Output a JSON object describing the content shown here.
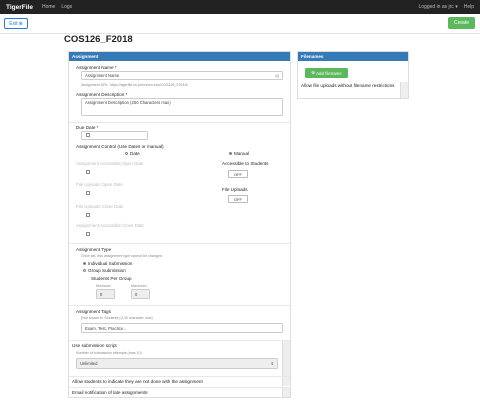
{
  "navbar": {
    "brand": "TigerFile",
    "links": [
      "Home",
      "Logs"
    ],
    "user": "Logged in as jrc ▾",
    "help": "Help"
  },
  "toolbar": {
    "exit_label": "Exit",
    "create_label": "Create"
  },
  "page_title": "COS126_F2018",
  "assignment_panel": {
    "heading": "Assignment",
    "name_label": "Assignment Name *",
    "name_placeholder": "Assignment Name",
    "url_help": "Assignment URL: https://tigerfile.cs.princeton.edu/COS126_F2018/",
    "description_label": "Assignment Description *",
    "description_placeholder": "Assignment Description (250 Characters max)",
    "due_date_label": "Due Date *",
    "control_label": "Assignment Control (Use Dates or manual)",
    "control_date": "Date",
    "control_manual": "Manual",
    "accessible_open_label": "Assignment Accessible Open Date",
    "accessible_to_students_label": "Accessible to Students",
    "accessible_toggle": "OFF",
    "upload_open_label": "File Uploads Open Date",
    "file_uploads_label": "File Uploads",
    "uploads_toggle": "OFF",
    "upload_close_label": "File Uploads Close Date",
    "accessible_close_label": "Assignment Accessible Close Date",
    "type_label": "Assignment Type",
    "type_help": "Once set, this assignment type cannot be changed.",
    "type_individual": "Individual Submission",
    "type_group": "Group Submission",
    "students_per_group": "Students Per Group",
    "minimum_label": "Minimum",
    "maximum_label": "Maximum",
    "minimum_value": "0",
    "maximum_value": "0",
    "tags_label": "Assignment Tags",
    "tags_help": "(Not shown to Students) (140 character max)",
    "tags_placeholder": "Exam, Test, Practice...",
    "script_label": "Use submission script",
    "attempts_help": "Number of submission attempts (max 10)",
    "attempts_value": "Unlimited",
    "not_done_label": "Allow students to indicate they are not done with the assignment",
    "late_label": "Email notification of late assignments"
  },
  "filenames_panel": {
    "heading": "Filenames",
    "add_label": "Add filename",
    "allow_uploads_label": "Allow file uploads without filename restrictions"
  },
  "colors": {
    "navbar": "#222222",
    "panel_heading": "#337ab7",
    "create_button": "#5cb85c",
    "exit_border": "#2a7ad1"
  }
}
